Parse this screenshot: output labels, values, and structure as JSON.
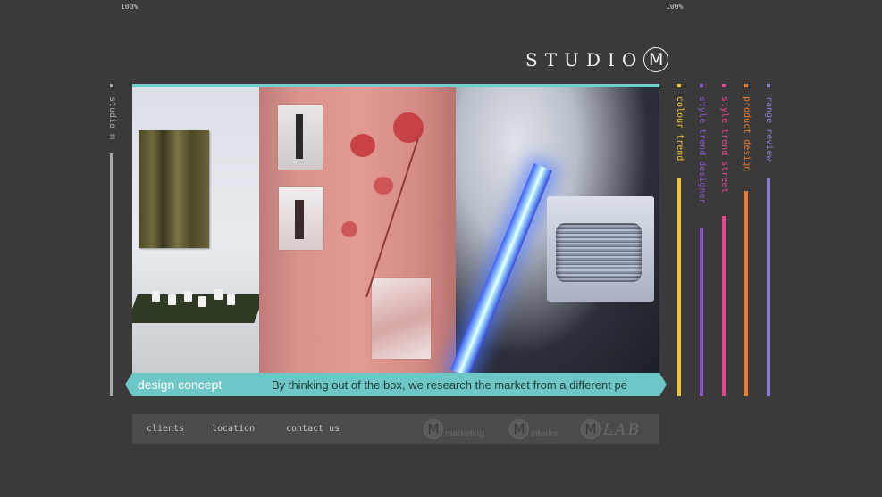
{
  "zoom": {
    "left": "100%",
    "right": "100%"
  },
  "logo": {
    "text": "STUDIO",
    "mark": "M"
  },
  "left_tab": {
    "label": "studio m",
    "color": "#a8a8a8"
  },
  "nav_tabs": [
    {
      "label": "colour trend",
      "color": "#f2c233"
    },
    {
      "label": "style trend designer",
      "color": "#8c55cf"
    },
    {
      "label": "style trend street",
      "color": "#e8458f"
    },
    {
      "label": "product design",
      "color": "#f07a2a"
    },
    {
      "label": "range review",
      "color": "#8a7fd6"
    }
  ],
  "banner": {
    "title": "design concept",
    "text": "By thinking out of the box, we research the market from a different pe"
  },
  "footer": {
    "links": [
      "clients",
      "location",
      "contact us"
    ],
    "sub_brands": [
      {
        "mark": "M",
        "label": "marketing"
      },
      {
        "mark": "M",
        "label": "interior"
      },
      {
        "mark": "M",
        "label": "LAB"
      }
    ]
  },
  "colors": {
    "background": "#3a3a3a",
    "accent": "#6ec6c6",
    "footer": "#4b4b4b"
  }
}
